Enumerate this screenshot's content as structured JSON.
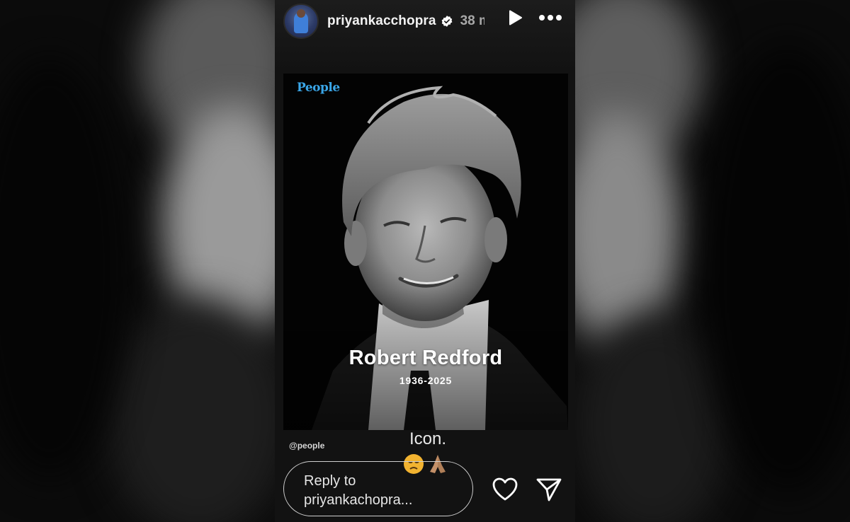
{
  "story": {
    "username": "priyankacchopra",
    "time": "38 m",
    "verified": true,
    "header_icons": [
      "play-icon",
      "more-icon"
    ]
  },
  "photo": {
    "brand": "People",
    "name": "Robert Redford",
    "years": "1936-2025",
    "mention": "@people"
  },
  "post": {
    "text": "Icon.",
    "emojis": [
      "disappointed-face-icon",
      "folded-hands-icon"
    ]
  },
  "reply": {
    "placeholder": "Reply to priyankachopra..."
  },
  "actions": [
    "heart-icon",
    "send-icon"
  ],
  "colors": {
    "background": "#0a0a0a",
    "panel": "#121212",
    "brand_blue": "#3aa6e8",
    "verified_badge": "#ffffff"
  }
}
